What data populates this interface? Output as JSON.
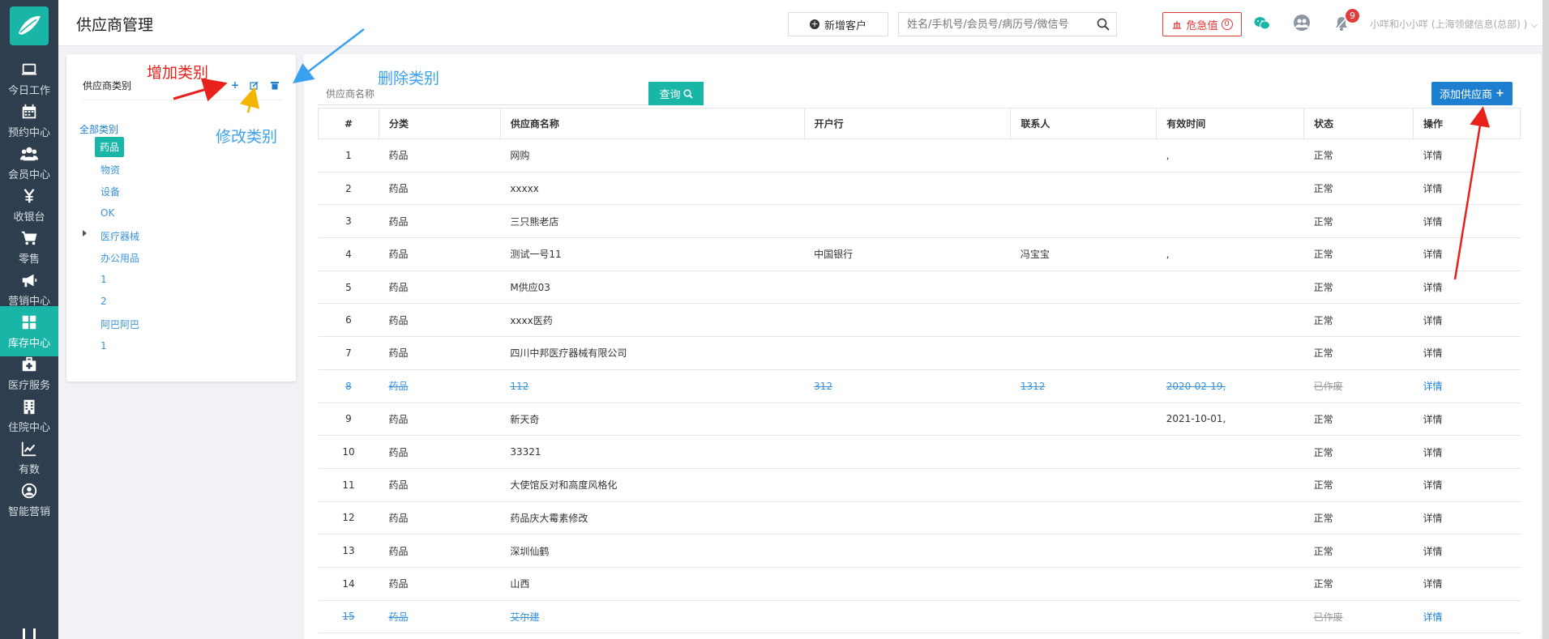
{
  "nav": {
    "items": [
      {
        "label": "今日工作",
        "icon": "laptop-icon"
      },
      {
        "label": "预约中心",
        "icon": "calendar-icon"
      },
      {
        "label": "会员中心",
        "icon": "users-icon"
      },
      {
        "label": "收银台",
        "icon": "yen-icon"
      },
      {
        "label": "零售",
        "icon": "cart-icon"
      },
      {
        "label": "营销中心",
        "icon": "megaphone-icon"
      },
      {
        "label": "库存中心",
        "icon": "grid-icon",
        "active": true
      },
      {
        "label": "医疗服务",
        "icon": "medical-kit-icon"
      },
      {
        "label": "住院中心",
        "icon": "hospital-icon"
      },
      {
        "label": "有数",
        "icon": "line-chart-icon"
      },
      {
        "label": "智能营销",
        "icon": "smart-marketing-icon"
      }
    ]
  },
  "header": {
    "title": "供应商管理",
    "new_customer": "新增客户",
    "search_placeholder": "姓名/手机号/会员号/病历号/微信号",
    "danger_label": "危急值",
    "danger_count": "0",
    "notify_count": "9",
    "user": "小咩和小小咩 (上海领健信息(总部) )"
  },
  "category": {
    "title": "供应商类别",
    "all_label": "全部类别",
    "items": [
      "药品",
      "物资",
      "设备",
      "OK",
      "医疗器械",
      "办公用品",
      "1",
      "2",
      "阿巴阿巴",
      "1"
    ]
  },
  "supplier": {
    "search_placeholder": "供应商名称",
    "query_label": "查询",
    "add_label": "添加供应商",
    "columns": [
      "#",
      "分类",
      "供应商名称",
      "开户行",
      "联系人",
      "有效时间",
      "状态",
      "操作"
    ],
    "rows": [
      [
        "1",
        "药品",
        "网购",
        "",
        "",
        ",",
        "正常",
        "详情"
      ],
      [
        "2",
        "药品",
        "xxxxx",
        "",
        "",
        "",
        "正常",
        "详情"
      ],
      [
        "3",
        "药品",
        "三只熊老店",
        "",
        "",
        "",
        "正常",
        "详情"
      ],
      [
        "4",
        "药品",
        "测试一号11",
        "中国银行",
        "冯宝宝",
        ",",
        "正常",
        "详情"
      ],
      [
        "5",
        "药品",
        "M供应03",
        "",
        "",
        "",
        "正常",
        "详情"
      ],
      [
        "6",
        "药品",
        "xxxx医药",
        "",
        "",
        "",
        "正常",
        "详情"
      ],
      [
        "7",
        "药品",
        "四川中邦医疗器械有限公司",
        "",
        "",
        "",
        "正常",
        "详情"
      ],
      [
        "8",
        "药品",
        "112",
        "312",
        "1312",
        "2020-02-19,",
        "已作废",
        "详情"
      ],
      [
        "9",
        "药品",
        "新天奇",
        "",
        "",
        "2021-10-01,",
        "正常",
        "详情"
      ],
      [
        "10",
        "药品",
        "33321",
        "",
        "",
        "",
        "正常",
        "详情"
      ],
      [
        "11",
        "药品",
        "大使馆反对和高度风格化",
        "",
        "",
        "",
        "正常",
        "详情"
      ],
      [
        "12",
        "药品",
        "药品庆大霉素修改",
        "",
        "",
        "",
        "正常",
        "详情"
      ],
      [
        "13",
        "药品",
        "深圳仙鹤",
        "",
        "",
        "",
        "正常",
        "详情"
      ],
      [
        "14",
        "药品",
        "山西",
        "",
        "",
        "",
        "正常",
        "详情"
      ],
      [
        "15",
        "药品",
        "艾尔建",
        "",
        "",
        "",
        "已作废",
        "详情"
      ]
    ]
  },
  "annotations": {
    "add_category": "增加类别",
    "delete_category": "删除类别",
    "edit_category": "修改类别"
  },
  "colors": {
    "sidebar": "#2f3e4e",
    "accent": "#19b5a6",
    "primary": "#1e7fd1",
    "danger": "#e23b3b"
  }
}
